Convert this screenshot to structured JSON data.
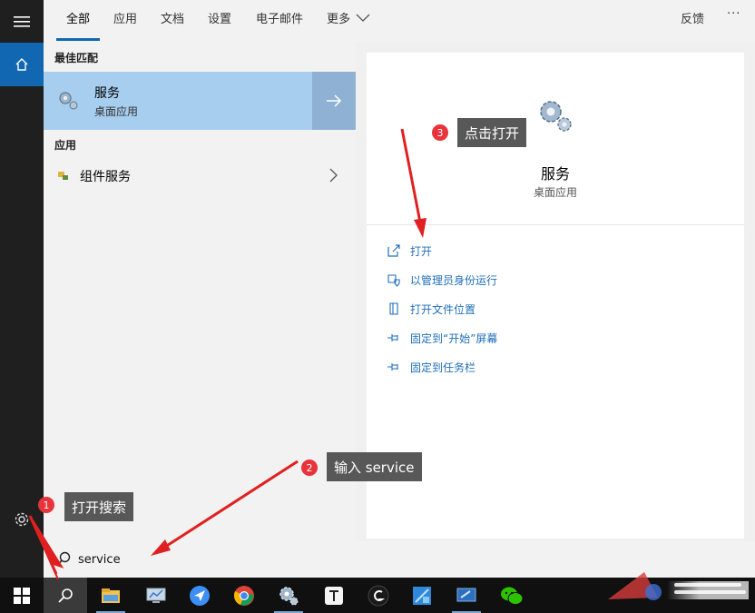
{
  "tabs": [
    {
      "label": "全部",
      "active": true
    },
    {
      "label": "应用"
    },
    {
      "label": "文档"
    },
    {
      "label": "设置"
    },
    {
      "label": "电子邮件"
    },
    {
      "label": "更多"
    }
  ],
  "header": {
    "feedback": "反馈",
    "more_options": "···"
  },
  "results": {
    "best_match_title": "最佳匹配",
    "best_match": {
      "name": "服务",
      "type": "桌面应用"
    },
    "apps_title": "应用",
    "apps": [
      {
        "name": "组件服务"
      }
    ]
  },
  "detail": {
    "name": "服务",
    "type": "桌面应用",
    "actions": [
      {
        "label": "打开",
        "icon": "open-icon"
      },
      {
        "label": "以管理员身份运行",
        "icon": "shield-icon"
      },
      {
        "label": "打开文件位置",
        "icon": "file-location-icon"
      },
      {
        "label": "固定到“开始”屏幕",
        "icon": "pin-icon"
      },
      {
        "label": "固定到任务栏",
        "icon": "pin-icon"
      }
    ]
  },
  "search": {
    "value": "service"
  },
  "annotations": [
    {
      "num": "1",
      "text": "打开搜索"
    },
    {
      "num": "2",
      "text": "输入 service"
    },
    {
      "num": "3",
      "text": "点击打开"
    }
  ],
  "colors": {
    "accent": "#1167b1",
    "selection": "#a7cdef",
    "callout": "#585858",
    "badge": "#e8333a",
    "arrow": "#e02020",
    "link": "#1f6fb8"
  },
  "taskbar_icons": [
    "windows-start-icon",
    "search-icon",
    "file-explorer-icon",
    "control-panel-icon",
    "feishu-icon",
    "chrome-icon",
    "settings-gear-icon",
    "typora-icon",
    "logitech-icon",
    "snipping-icon",
    "remote-desktop-icon",
    "wechat-icon"
  ]
}
